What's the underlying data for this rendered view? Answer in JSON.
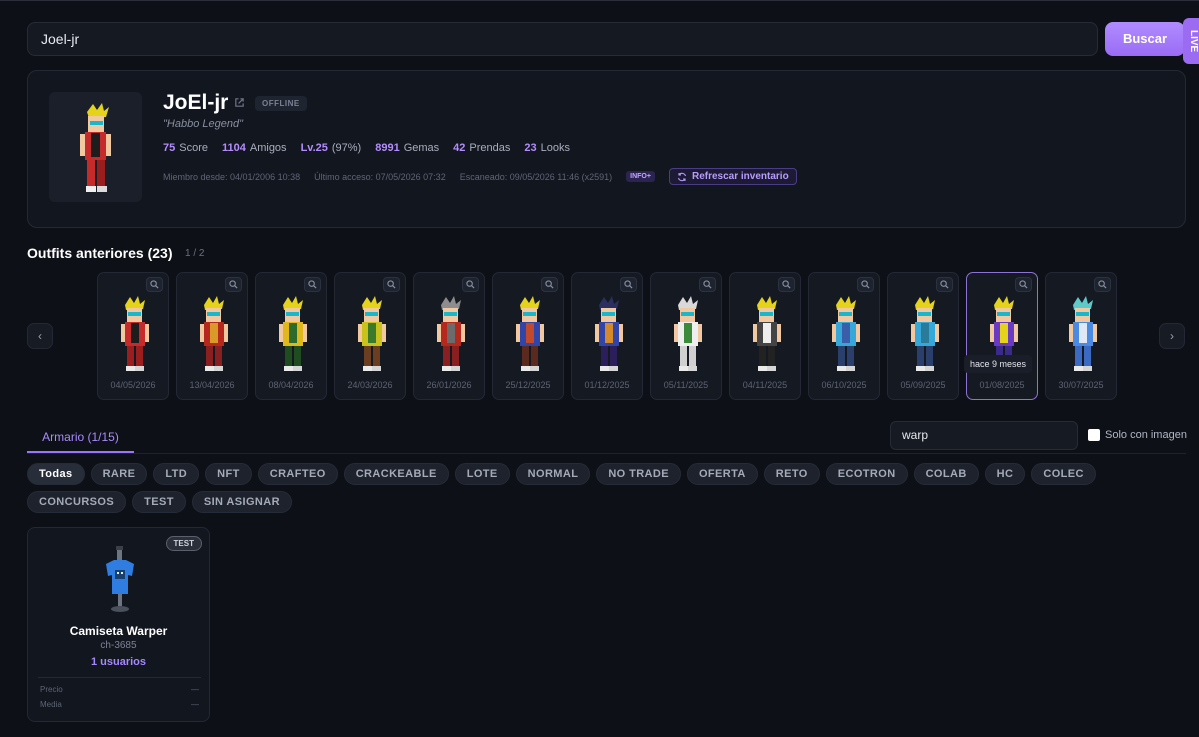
{
  "search": {
    "value": "Joel-jr",
    "button_label": "Buscar",
    "side_tab": "LIVE"
  },
  "profile": {
    "name": "JoEl-jr",
    "status": "OFFLINE",
    "motto": "\"Habbo Legend\"",
    "stats": [
      {
        "value": "75",
        "label": "Score"
      },
      {
        "value": "1104",
        "label": "Amigos"
      },
      {
        "value": "Lv.25",
        "label": "(97%)"
      },
      {
        "value": "8991",
        "label": "Gemas"
      },
      {
        "value": "42",
        "label": "Prendas"
      },
      {
        "value": "23",
        "label": "Looks"
      }
    ],
    "member_since": "Miembro desde: 04/01/2006 10:38",
    "last_access": "Último acceso: 07/05/2026 07:32",
    "scanned": "Escaneado: 09/05/2026 11:46 (x2591)",
    "info_badge": "INFO+",
    "refresh_label": "Refrescar inventario"
  },
  "outfits": {
    "title": "Outfits anteriores (23)",
    "page": "1 / 2",
    "items": [
      {
        "date": "04/05/2026"
      },
      {
        "date": "13/04/2026"
      },
      {
        "date": "08/04/2026"
      },
      {
        "date": "24/03/2026"
      },
      {
        "date": "26/01/2026"
      },
      {
        "date": "25/12/2025"
      },
      {
        "date": "01/12/2025"
      },
      {
        "date": "05/11/2025"
      },
      {
        "date": "04/11/2025"
      },
      {
        "date": "06/10/2025"
      },
      {
        "date": "05/09/2025"
      },
      {
        "date": "01/08/2025"
      },
      {
        "date": "30/07/2025"
      }
    ],
    "tooltip": "hace 9 meses"
  },
  "wardrobe": {
    "tab_label": "Armario (1/15)",
    "filter_value": "warp",
    "only_with_image": "Solo con imagen",
    "chips": [
      "Todas",
      "RARE",
      "LTD",
      "NFT",
      "CRAFTEO",
      "CRACKEABLE",
      "LOTE",
      "NORMAL",
      "NO TRADE",
      "OFERTA",
      "RETO",
      "ECOTRON",
      "COLAB",
      "HC",
      "COLEC",
      "CONCURSOS",
      "TEST",
      "SIN ASIGNAR"
    ],
    "item": {
      "badge": "TEST",
      "name": "Camiseta Warper",
      "code": "ch-3685",
      "users": "1 usuarios",
      "price_label": "Precio",
      "price_value": "—",
      "media_label": "Media",
      "media_value": "—"
    }
  },
  "colors": {
    "accent": "#9a74ff",
    "background": "#0d1017"
  }
}
